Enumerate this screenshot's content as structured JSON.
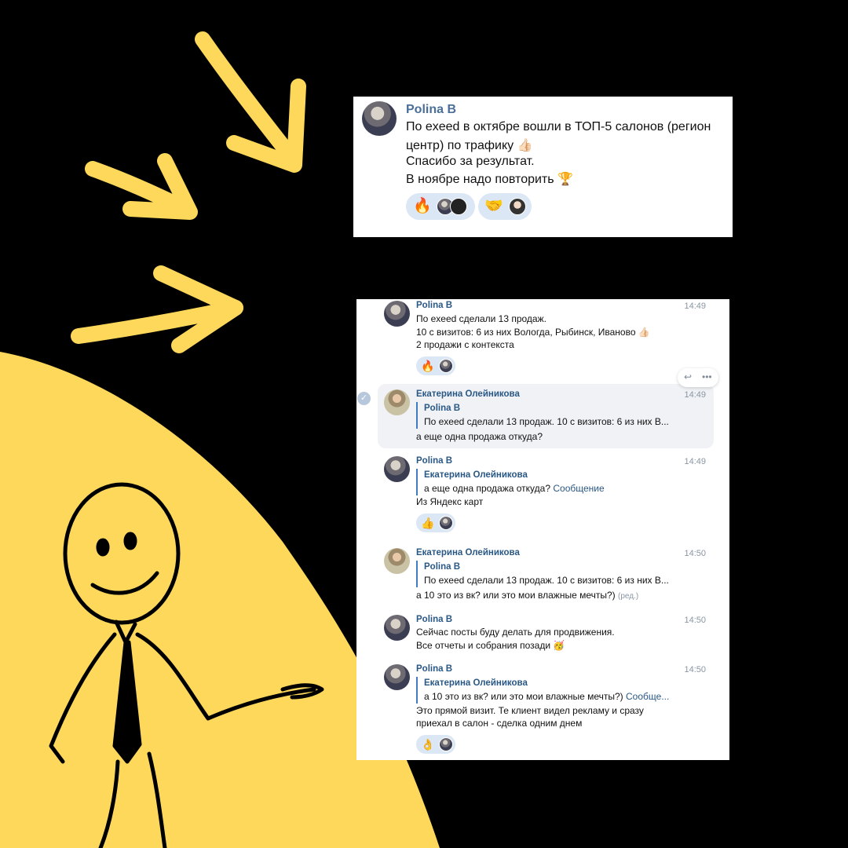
{
  "colors": {
    "background": "#000000",
    "accent_yellow": "#fdd85a",
    "link_blue": "#2a5885",
    "reaction_bg": "#dbe7f5"
  },
  "top_post": {
    "author": "Polina B",
    "lines": [
      "По exeed в октябре вошли в ТОП-5 салонов (регион",
      "центр) по трафику 👍🏻",
      "Спасибо за результат.",
      "В ноябре надо повторить 🏆"
    ],
    "reactions": [
      "🔥",
      "🤝"
    ]
  },
  "chat": {
    "message_tools": {
      "reply_icon": "reply-icon",
      "more_icon": "more-icon"
    },
    "messages": [
      {
        "author": "Polina B",
        "time": "14:49",
        "lines": [
          "По exeed сделали 13 продаж.",
          "10 с визитов: 6 из них Вологда, Рыбинск, Иваново 👍🏻",
          "2 продажи с контекста"
        ],
        "reaction": "🔥"
      },
      {
        "author": "Екатерина Олейникова",
        "time": "14:49",
        "quote_author": "Polina B",
        "quote_text": "По exeed сделали 13 продаж. 10 с визитов: 6 из них В...",
        "lines": [
          "а еще одна продажа откуда?"
        ]
      },
      {
        "author": "Polina B",
        "time": "14:49",
        "quote_author": "Екатерина Олейникова",
        "quote_text": "а еще одна продажа откуда?",
        "quote_link": "Сообщение",
        "lines": [
          "Из Яндекс карт"
        ],
        "reaction": "👍"
      },
      {
        "author": "Екатерина Олейникова",
        "time": "14:50",
        "quote_author": "Polina B",
        "quote_text": "По exeed сделали 13 продаж. 10 с визитов: 6 из них В...",
        "lines": [
          "а 10 это из вк? или это мои влажные мечты?)"
        ],
        "edited": "(ред.)"
      },
      {
        "author": "Polina B",
        "time": "14:50",
        "lines": [
          "Сейчас посты буду делать для продвижения.",
          "Все отчеты и собрания позади 🥳"
        ]
      },
      {
        "author": "Polina B",
        "time": "14:50",
        "quote_author": "Екатерина Олейникова",
        "quote_text": "а 10 это из вк? или это мои влажные мечты?)",
        "quote_link": "Сообще...",
        "lines": [
          "Это прямой визит. Те клиент видел рекламу и сразу",
          "приехал в салон - сделка одним днем"
        ],
        "reaction": "👌"
      }
    ]
  }
}
